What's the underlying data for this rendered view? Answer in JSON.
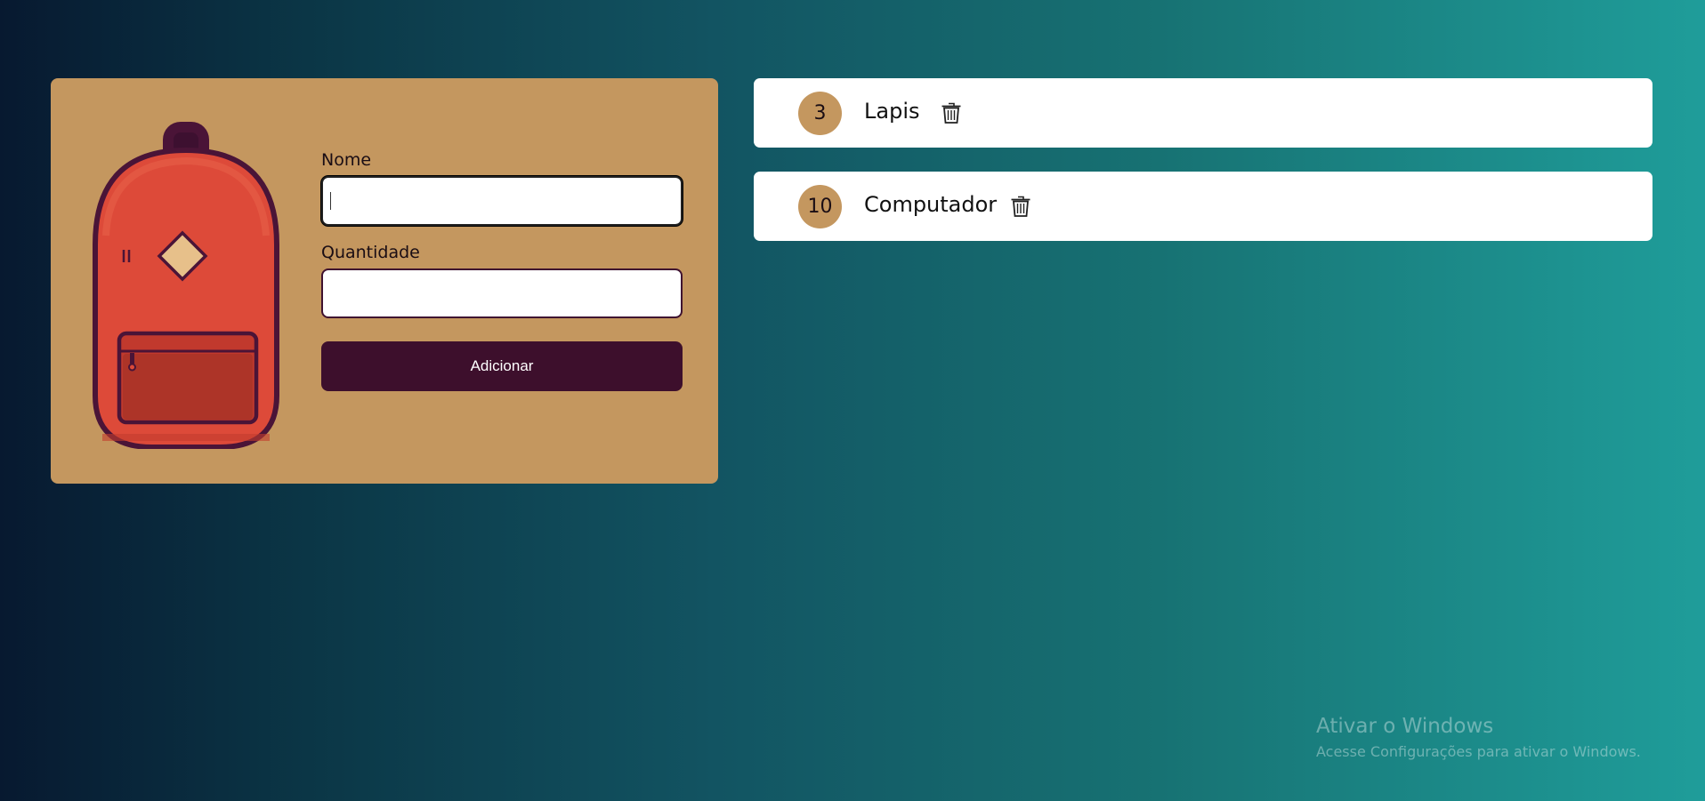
{
  "form": {
    "name_label": "Nome",
    "name_value": "",
    "quantity_label": "Quantidade",
    "quantity_value": "",
    "submit_label": "Adicionar"
  },
  "items": [
    {
      "quantity": "3",
      "name": "Lapis"
    },
    {
      "quantity": "10",
      "name": "Computador"
    }
  ],
  "watermark": {
    "title": "Ativar o Windows",
    "subtitle": "Acesse Configurações para ativar o Windows."
  },
  "colors": {
    "card": "#c4975f",
    "button": "#3d0f2c",
    "backpack": "#dd4a39"
  },
  "icons": {
    "delete": "trash-icon",
    "illustration": "backpack-illustration"
  }
}
